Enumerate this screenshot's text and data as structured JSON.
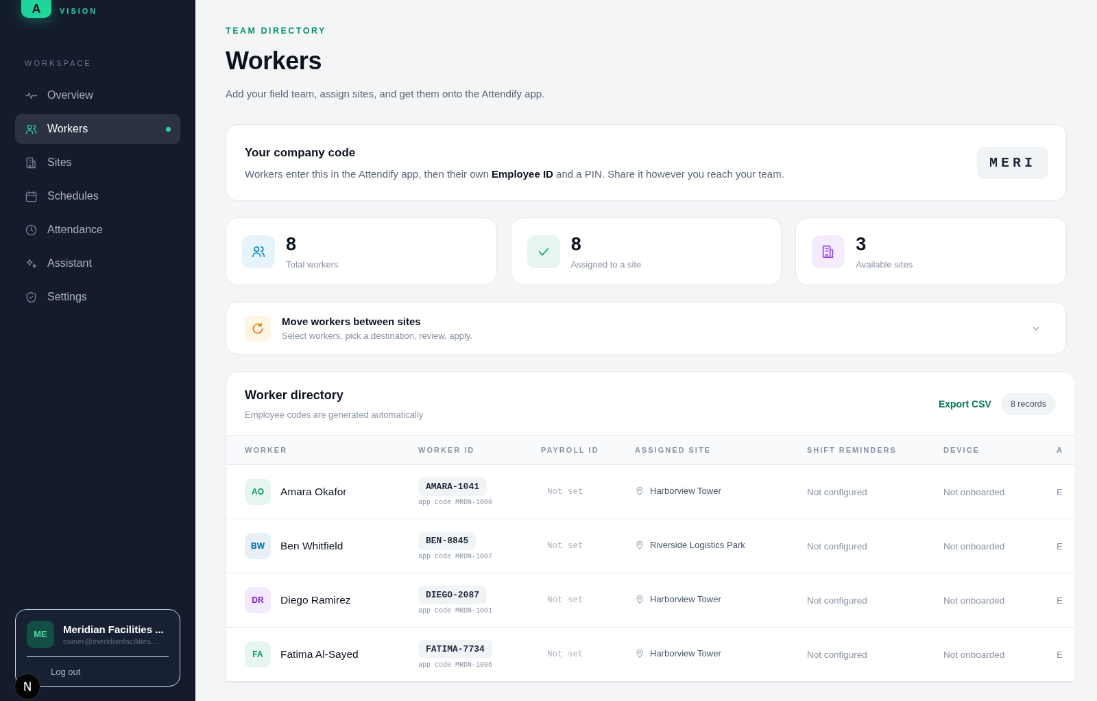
{
  "sidebar": {
    "brand": {
      "logo_letter": "A",
      "tagline": "VISION"
    },
    "section_label": "WORKSPACE",
    "items": [
      {
        "label": "Overview",
        "selected": false
      },
      {
        "label": "Workers",
        "selected": true
      },
      {
        "label": "Sites",
        "selected": false
      },
      {
        "label": "Schedules",
        "selected": false
      },
      {
        "label": "Attendance",
        "selected": false
      },
      {
        "label": "Assistant",
        "selected": false
      },
      {
        "label": "Settings",
        "selected": false
      }
    ],
    "account": {
      "initials": "ME",
      "name": "Meridian Facilities ...",
      "email": "owner@meridianfacilities...."
    },
    "logout": "Log out",
    "dev_indicator": "N"
  },
  "header": {
    "eyebrow": "TEAM DIRECTORY",
    "title": "Workers",
    "subtitle": "Add your field team, assign sites, and get them onto the Attendify app."
  },
  "company_code": {
    "title": "Your company code",
    "text": "Workers enter this in the Attendify app, then their own **Employee ID** and a PIN. Share it however you reach your team.",
    "code": "MERI"
  },
  "stats": [
    {
      "value": "8",
      "label": "Total workers",
      "color": "#0284c7"
    },
    {
      "value": "8",
      "label": "Assigned to a site",
      "color": "#059669"
    },
    {
      "value": "3",
      "label": "Available sites",
      "color": "#9333ea"
    }
  ],
  "move_panel": {
    "title": "Move workers between sites",
    "subtitle": "Select workers, pick a destination, review, apply.",
    "expanded": false
  },
  "directory": {
    "title": "Worker directory",
    "subtitle": "Employee codes are generated automatically",
    "export": "Export CSV",
    "count": "8 records",
    "columns": [
      "WORKER",
      "WORKER ID",
      "PAYROLL ID",
      "ASSIGNED SITE",
      "SHIFT REMINDERS",
      "DEVICE",
      "A"
    ],
    "rows": [
      {
        "initials": "AO",
        "color": "#059669",
        "name": "Amara Okafor",
        "worker_id": "AMARA-1041",
        "app_code": "app code MRDN-1000",
        "payroll_id": "Not set",
        "site": "Harborview Tower",
        "reminders": "Not configured",
        "device": "Not onboarded",
        "column_7": "E"
      },
      {
        "initials": "BW",
        "color": "#0369a1",
        "name": "Ben Whitfield",
        "worker_id": "BEN-8845",
        "app_code": "app code MRDN-1007",
        "payroll_id": "Not set",
        "site": "Riverside Logistics Park",
        "reminders": "Not configured",
        "device": "Not onboarded",
        "column_7": "E"
      },
      {
        "initials": "DR",
        "color": "#7e22ce",
        "name": "Diego Ramirez",
        "worker_id": "DIEGO-2087",
        "app_code": "app code MRDN-1001",
        "payroll_id": "Not set",
        "site": "Harborview Tower",
        "reminders": "Not configured",
        "device": "Not onboarded",
        "column_7": "E"
      },
      {
        "initials": "FA",
        "color": "#059669",
        "name": "Fatima Al-Sayed",
        "worker_id": "FATIMA-7734",
        "app_code": "app code MRDN-1006",
        "payroll_id": "Not set",
        "site": "Harborview Tower",
        "reminders": "Not configured",
        "device": "Not onboarded",
        "column_7": "E"
      }
    ]
  }
}
